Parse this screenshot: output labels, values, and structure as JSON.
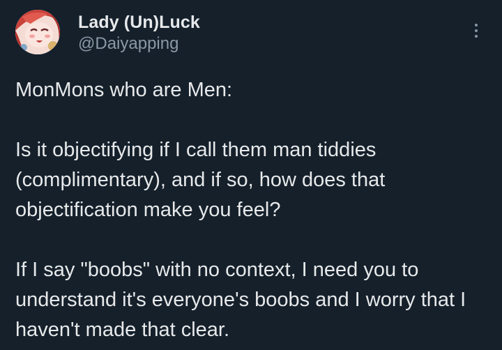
{
  "author": {
    "display_name": "Lady (Un)Luck",
    "handle": "@Daiyapping",
    "avatar_icon": "avatar-illustration"
  },
  "actions": {
    "more_icon": "more-vertical-icon"
  },
  "tweet": {
    "paragraphs": [
      "MonMons who are Men:",
      "Is it objectifying if I call them man tiddies (complimentary), and if so, how does that objectification make you feel?",
      "If I say \"boobs\" with no context, I need you to understand it's everyone's boobs and I worry that I haven't made that clear."
    ]
  },
  "colors": {
    "background": "#15202b",
    "text": "#e7e9ea",
    "secondary_text": "#8b98a5"
  }
}
